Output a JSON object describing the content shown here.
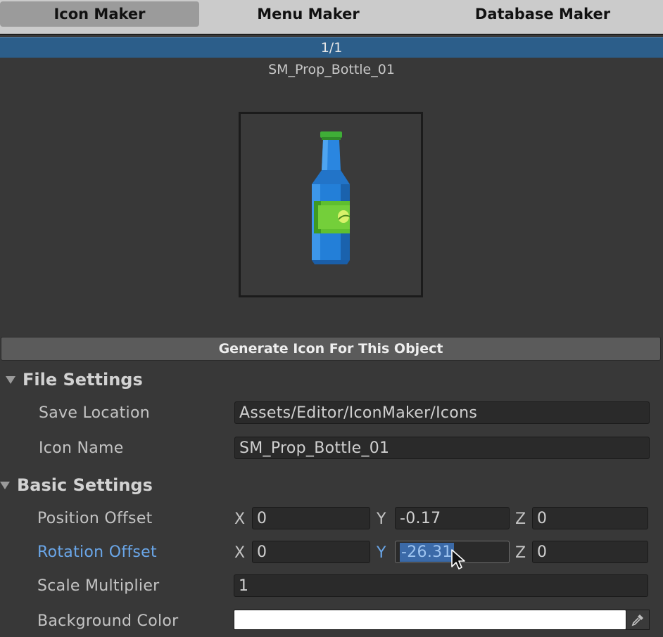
{
  "tabs": [
    {
      "label": "Icon Maker",
      "active": true
    },
    {
      "label": "Menu Maker",
      "active": false
    },
    {
      "label": "Database Maker",
      "active": false
    }
  ],
  "pager": {
    "text": "1/1"
  },
  "object": {
    "name": "SM_Prop_Bottle_01"
  },
  "generate_button": "Generate Icon For This Object",
  "file_settings": {
    "title": "File Settings",
    "save_location_label": "Save Location",
    "save_location_value": "Assets/Editor/IconMaker/Icons",
    "icon_name_label": "Icon Name",
    "icon_name_value": "SM_Prop_Bottle_01"
  },
  "basic_settings": {
    "title": "Basic Settings",
    "position": {
      "label": "Position Offset",
      "x": "0",
      "y": "-0.17",
      "z": "0"
    },
    "rotation": {
      "label": "Rotation Offset",
      "x": "0",
      "y": "-26.31",
      "z": "0"
    },
    "scale": {
      "label": "Scale Multiplier",
      "value": "1"
    },
    "background": {
      "label": "Background Color",
      "color": "#ffffff"
    }
  },
  "axis_labels": {
    "x": "X",
    "y": "Y",
    "z": "Z"
  },
  "colors": {
    "accent": "#2c5e8a",
    "highlight_label": "#6aa6e8",
    "selection": "#3b6aa8"
  },
  "icons": [
    "foldout-triangle-icon",
    "eyedropper-icon",
    "mouse-cursor-icon",
    "bottle-preview-image"
  ]
}
